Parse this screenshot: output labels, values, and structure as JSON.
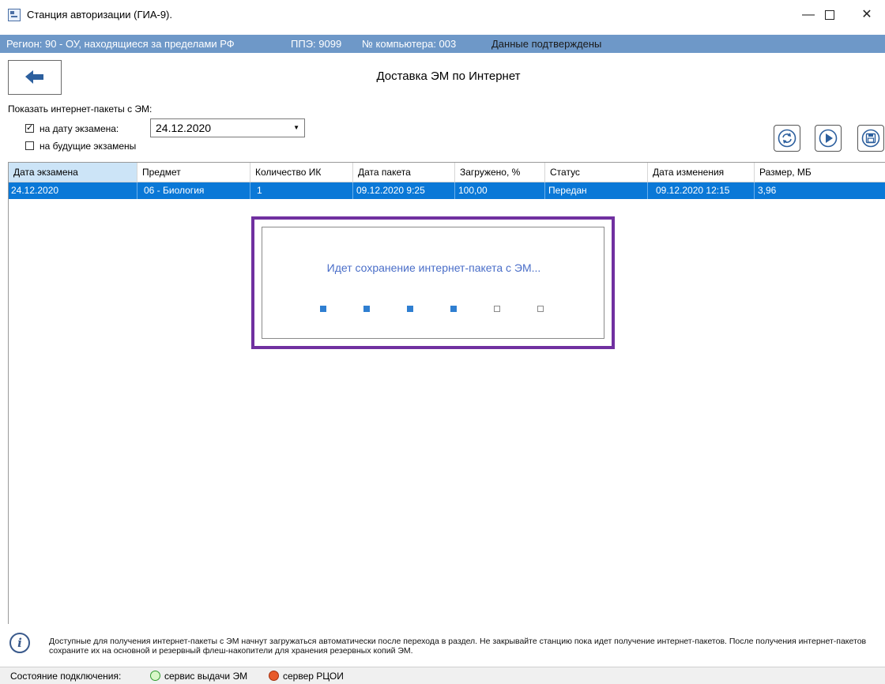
{
  "window": {
    "title": "Станция авторизации (ГИА-9).",
    "min": "—",
    "close": "✕"
  },
  "infobar": {
    "region": "Регион: 90 - ОУ, находящиеся за пределами РФ",
    "ppe": "ППЭ: 9099",
    "computer": "№ компьютера: 003",
    "status": "Данные подтверждены"
  },
  "page": {
    "title": "Доставка ЭМ по Интернет",
    "show_label": "Показать интернет-пакеты с ЭМ:",
    "check_exam_date": "на дату экзамена:",
    "check_future": "на будущие экзамены",
    "exam_date_value": "24.12.2020"
  },
  "table": {
    "columns": [
      "Дата экзамена",
      "Предмет",
      "Количество ИК",
      "Дата пакета",
      "Загружено, %",
      "Статус",
      "Дата изменения",
      "Размер, МБ"
    ],
    "rows": [
      [
        "24.12.2020",
        "06 - Биология",
        "1",
        "09.12.2020 9:25",
        "100,00",
        "Передан",
        "09.12.2020 12:15",
        "3,96"
      ]
    ]
  },
  "progress": {
    "message": "Идет сохранение интернет-пакета с ЭМ...",
    "steps_done": 4,
    "steps_total": 6
  },
  "note": {
    "text": "Доступные для получения интернет-пакеты с ЭМ начнут загружаться автоматически после перехода в раздел. Не закрывайте станцию пока идет получение интернет-пакетов. После получения интернет-пакетов сохраните их на основной и резервный флеш-накопители для хранения резервных копий ЭМ."
  },
  "status": {
    "label": "Состояние подключения:",
    "service": "сервис выдачи ЭМ",
    "server": "сервер РЦОИ",
    "service_color": "#2f9a2f",
    "server_color": "#e85a2a"
  },
  "icons": [
    "app-icon",
    "back-arrow-icon",
    "refresh-icon",
    "play-icon",
    "save-icon",
    "info-icon",
    "dropdown-arrow-icon"
  ]
}
